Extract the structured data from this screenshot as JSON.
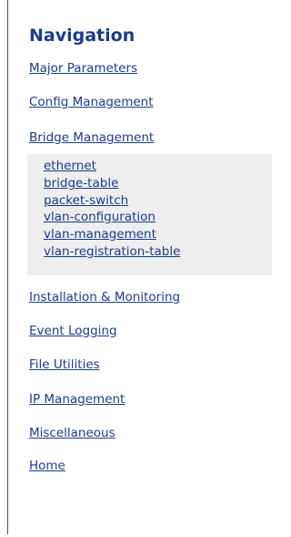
{
  "nav": {
    "title": "Navigation",
    "items": [
      {
        "label": "Major Parameters"
      },
      {
        "label": "Config Management"
      },
      {
        "label": "Bridge Management"
      },
      {
        "label": "Installation & Monitoring"
      },
      {
        "label": "Event Logging"
      },
      {
        "label": "File Utilities"
      },
      {
        "label": "IP Management"
      },
      {
        "label": "Miscellaneous"
      },
      {
        "label": "Home"
      }
    ],
    "submenu": [
      {
        "label": "ethernet"
      },
      {
        "label": "bridge-table"
      },
      {
        "label": "packet-switch"
      },
      {
        "label": "vlan-configuration"
      },
      {
        "label": "vlan-management"
      },
      {
        "label": "vlan-registration-table"
      }
    ]
  },
  "colors": {
    "link": "#1a3c8c",
    "submenu_bg": "#eeeeee"
  }
}
